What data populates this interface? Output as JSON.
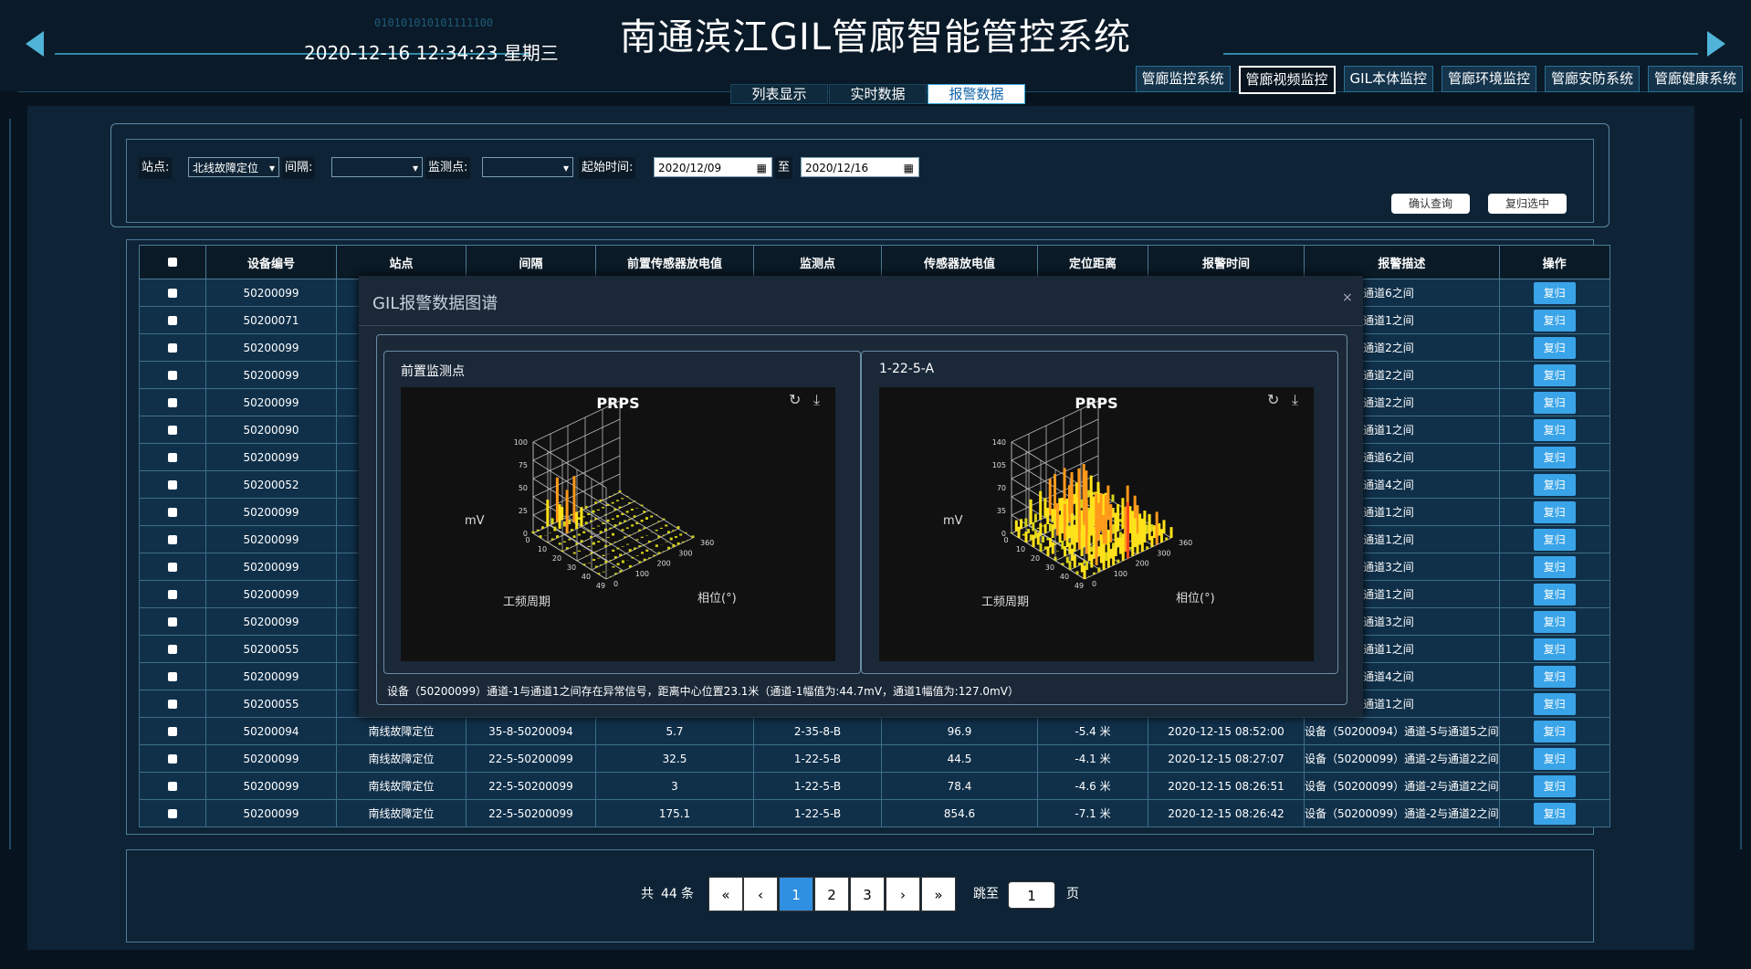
{
  "header": {
    "title": "南通滨江GIL管廊智能管控系统",
    "datetime": "2020-12-16 12:34:23 星期三",
    "binary_deco": "010101010101111100"
  },
  "tabs": [
    {
      "label": "列表显示",
      "active": false
    },
    {
      "label": "实时数据",
      "active": false
    },
    {
      "label": "报警数据",
      "active": true
    }
  ],
  "sysnav": [
    {
      "label": "管廊监控系统",
      "active": false
    },
    {
      "label": "管廊视频监控",
      "active": true
    },
    {
      "label": "GIL本体监控",
      "active": false
    },
    {
      "label": "管廊环境监控",
      "active": false
    },
    {
      "label": "管廊安防系统",
      "active": false
    },
    {
      "label": "管廊健康系统",
      "active": false
    }
  ],
  "filters": {
    "station_label": "站点:",
    "station_value": "北线故障定位",
    "interval_label": "间隔:",
    "interval_value": "",
    "monitor_label": "监测点:",
    "monitor_value": "",
    "start_label": "起始时间:",
    "start_date": "2020/12/09",
    "to_label": "至",
    "end_date": "2020/12/16",
    "confirm_btn": "确认查询",
    "reset_btn": "复归选中"
  },
  "table": {
    "headers": [
      "设备编号",
      "站点",
      "间隔",
      "前置传感器放电值",
      "监测点",
      "传感器放电值",
      "定位距离",
      "报警时间",
      "报警描述",
      "操作"
    ],
    "action_label": "复归",
    "rows": [
      {
        "id": "50200099",
        "desc": "9)  通道-6与通道6之间"
      },
      {
        "id": "50200071",
        "desc": "1)  通道-1与通道1之间"
      },
      {
        "id": "50200099",
        "desc": "9)  通道-2与通道2之间"
      },
      {
        "id": "50200099",
        "desc": "9)  通道-2与通道2之间"
      },
      {
        "id": "50200099",
        "desc": "9)  通道-2与通道2之间"
      },
      {
        "id": "50200090",
        "desc": "0)  通道-1与通道1之间"
      },
      {
        "id": "50200099",
        "desc": "9)  通道-6与通道6之间"
      },
      {
        "id": "50200052",
        "desc": "2)  通道-4与通道4之间"
      },
      {
        "id": "50200099",
        "desc": "9)  通道-1与通道1之间"
      },
      {
        "id": "50200099",
        "desc": "9)  通道-1与通道1之间"
      },
      {
        "id": "50200099",
        "desc": "9)  通道-3与通道3之间"
      },
      {
        "id": "50200099",
        "desc": "9)  通道-1与通道1之间"
      },
      {
        "id": "50200099",
        "desc": "9)  通道-3与通道3之间"
      },
      {
        "id": "50200055",
        "desc": "5)  通道-1与通道1之间"
      },
      {
        "id": "50200099",
        "desc": "9)  通道-4与通道4之间"
      },
      {
        "id": "50200055",
        "desc": "5)  通道-1与通道1之间"
      }
    ],
    "full_rows": [
      {
        "id": "50200094",
        "station": "南线故障定位",
        "interval": "35-8-50200094",
        "pre": "5.7",
        "point": "2-35-8-B",
        "val": "96.9",
        "dist": "-5.4 米",
        "time": "2020-12-15 08:52:00",
        "desc": "设备（50200094）通道-5与通道5之间"
      },
      {
        "id": "50200099",
        "station": "南线故障定位",
        "interval": "22-5-50200099",
        "pre": "32.5",
        "point": "1-22-5-B",
        "val": "44.5",
        "dist": "-4.1 米",
        "time": "2020-12-15 08:27:07",
        "desc": "设备（50200099）通道-2与通道2之间"
      },
      {
        "id": "50200099",
        "station": "南线故障定位",
        "interval": "22-5-50200099",
        "pre": "3",
        "point": "1-22-5-B",
        "val": "78.4",
        "dist": "-4.6 米",
        "time": "2020-12-15 08:26:51",
        "desc": "设备（50200099）通道-2与通道2之间"
      },
      {
        "id": "50200099",
        "station": "南线故障定位",
        "interval": "22-5-50200099",
        "pre": "175.1",
        "point": "1-22-5-B",
        "val": "854.6",
        "dist": "-7.1 米",
        "time": "2020-12-15 08:26:42",
        "desc": "设备（50200099）通道-2与通道2之间"
      }
    ]
  },
  "pager": {
    "total_prefix": "共",
    "total": "44",
    "total_suffix": "条",
    "first": "«",
    "prev": "‹",
    "pages": [
      "1",
      "2",
      "3"
    ],
    "next": "›",
    "last": "»",
    "jump_label": "跳至",
    "jump_value": "1",
    "page_label": "页"
  },
  "modal": {
    "title": "GIL报警数据图谱",
    "close": "×",
    "footer": "设备（50200099）通道-1与通道1之间存在异常信号，距离中心位置23.1米（通道-1幅值为:44.7mV，通道1幅值为:127.0mV）",
    "charts": [
      {
        "card_title": "前置监测点",
        "chart_title": "PRPS",
        "z_label": "mV",
        "x_label": "工频周期",
        "y_label": "相位(°)",
        "z_ticks": [
          "100",
          "75",
          "50",
          "25",
          "0"
        ],
        "x_ticks": [
          "0",
          "10",
          "20",
          "30",
          "40",
          "49"
        ],
        "y_ticks": [
          "0",
          "100",
          "200",
          "300",
          "360"
        ]
      },
      {
        "card_title": "1-22-5-A",
        "chart_title": "PRPS",
        "z_label": "mV",
        "x_label": "工频周期",
        "y_label": "相位(°)",
        "z_ticks": [
          "140",
          "105",
          "70",
          "35",
          "0"
        ],
        "x_ticks": [
          "0",
          "10",
          "20",
          "30",
          "40",
          "49"
        ],
        "y_ticks": [
          "0",
          "100",
          "200",
          "300",
          "360"
        ]
      }
    ]
  },
  "icons": {
    "refresh": "refresh-icon",
    "download": "download-icon",
    "close": "close-icon"
  }
}
